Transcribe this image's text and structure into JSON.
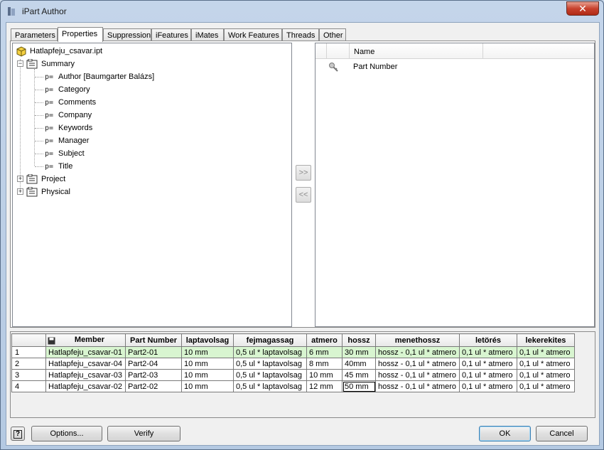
{
  "window": {
    "title": "iPart Author"
  },
  "tabs": [
    "Parameters",
    "Properties",
    "Suppression",
    "iFeatures",
    "iMates",
    "Work Features",
    "Threads",
    "Other"
  ],
  "active_tab": "Properties",
  "tree": {
    "root": "Hatlapfeju_csavar.ipt",
    "summary": {
      "label": "Summary",
      "badge": "p=",
      "items": [
        "Author [Baumgarter Balázs]",
        "Category",
        "Comments",
        "Company",
        "Keywords",
        "Manager",
        "Subject",
        "Title"
      ]
    },
    "project": "Project",
    "physical": "Physical"
  },
  "transfer": {
    "add": ">>",
    "remove": "<<"
  },
  "selected_list": {
    "header": "Name",
    "items": [
      "Part Number"
    ]
  },
  "grid": {
    "columns": [
      "Member",
      "Part Number",
      "laptavolsag",
      "fejmagassag",
      "atmero",
      "hossz",
      "menethossz",
      "letörés",
      "lekerekites"
    ],
    "rows": [
      {
        "num": "1",
        "cells": [
          "Hatlapfeju_csavar-01",
          "Part2-01",
          "10 mm",
          "0,5 ul * laptavolsag",
          "6 mm",
          "30 mm",
          "hossz - 0,1 ul * atmero",
          "0,1 ul * atmero",
          "0,1 ul * atmero"
        ]
      },
      {
        "num": "2",
        "cells": [
          "Hatlapfeju_csavar-04",
          "Part2-04",
          "10 mm",
          "0,5 ul * laptavolsag",
          "8 mm",
          "40mm",
          "hossz - 0,1 ul * atmero",
          "0,1 ul * atmero",
          "0,1 ul * atmero"
        ]
      },
      {
        "num": "3",
        "cells": [
          "Hatlapfeju_csavar-03",
          "Part2-03",
          "10 mm",
          "0,5 ul * laptavolsag",
          "10 mm",
          "45 mm",
          "hossz - 0,1 ul * atmero",
          "0,1 ul * atmero",
          "0,1 ul * atmero"
        ]
      },
      {
        "num": "4",
        "cells": [
          "Hatlapfeju_csavar-02",
          "Part2-02",
          "10 mm",
          "0,5 ul * laptavolsag",
          "12 mm",
          "50 mm",
          "hossz - 0,1 ul * atmero",
          "0,1 ul * atmero",
          "0,1 ul * atmero"
        ]
      }
    ]
  },
  "buttons": {
    "help": "?",
    "options": "Options...",
    "verify": "Verify",
    "ok": "OK",
    "cancel": "Cancel"
  }
}
